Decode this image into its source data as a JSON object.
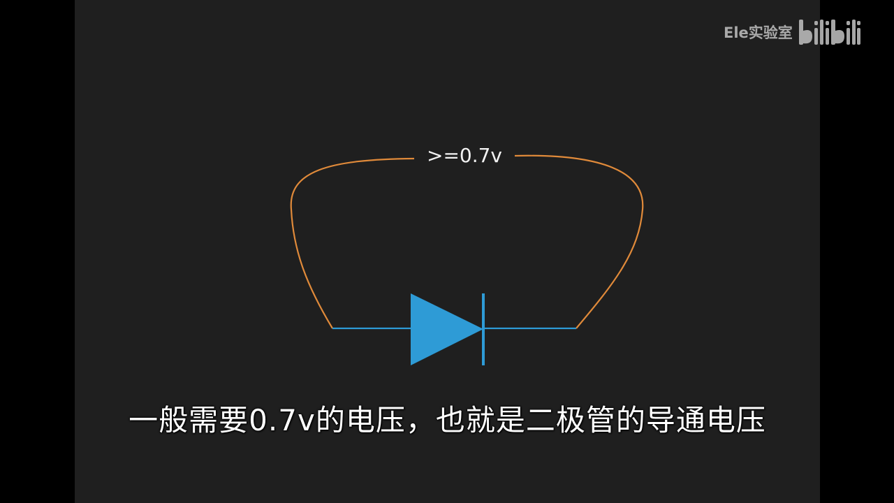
{
  "watermark": {
    "channel_name": "Ele实验室",
    "platform_logo_text": "bilibili",
    "logo_icon": "bilibili-logo-icon"
  },
  "diagram": {
    "voltage_label": ">=0.7v",
    "component": "diode",
    "colors": {
      "background": "#1f1f1f",
      "loop_wire": "#e08a3a",
      "diode": "#2e9bd6",
      "label_text": "#f2f2f2"
    }
  },
  "subtitle": {
    "text": "一般需要0.7v的电压，也就是二极管的导通电压"
  }
}
